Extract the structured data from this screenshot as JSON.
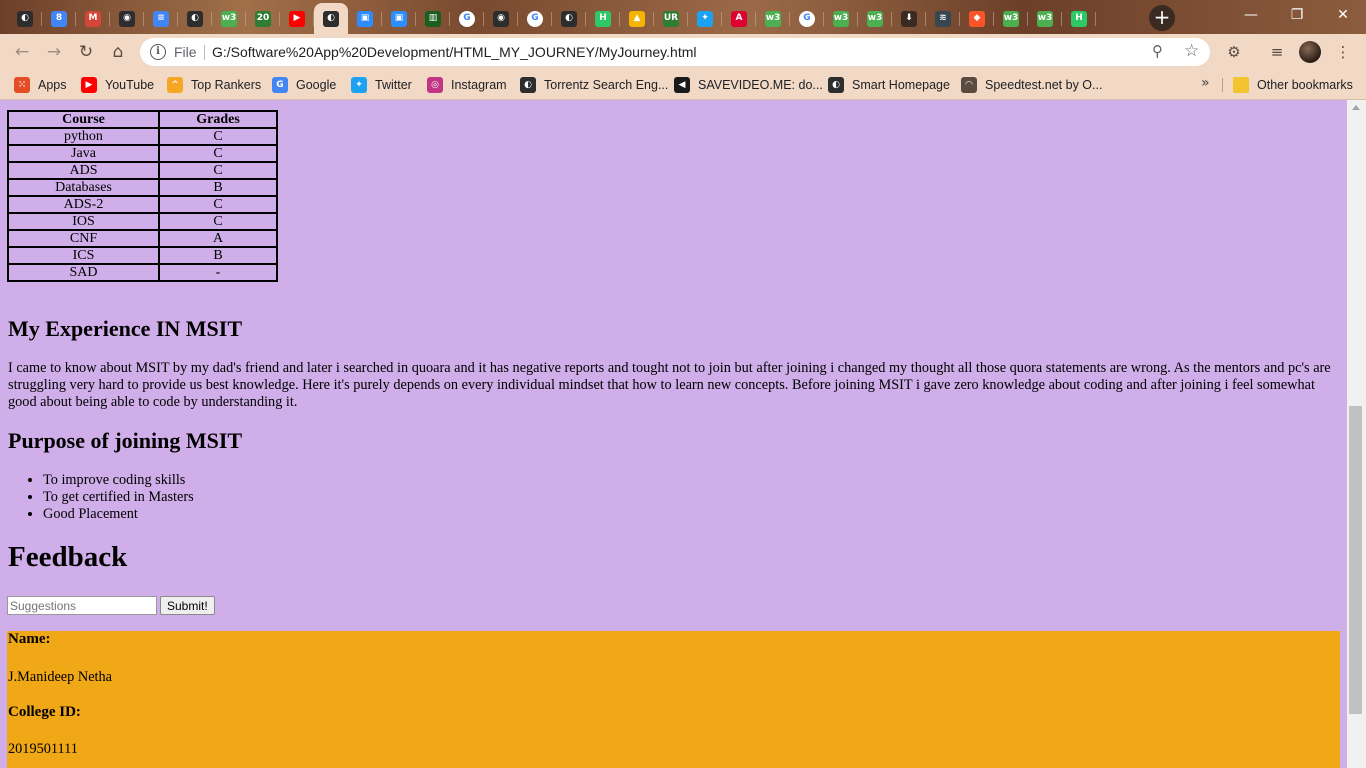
{
  "window": {
    "minimize_glyph": "—",
    "restore_glyph": "❐",
    "close_glyph": "✕",
    "new_tab_glyph": "+"
  },
  "tabs": [
    {
      "icon": "globe-icon",
      "glyph": "◐",
      "color": "#2d2d2d"
    },
    {
      "icon": "calendar-icon",
      "glyph": "8",
      "color": "#4285f4"
    },
    {
      "icon": "gmail-icon",
      "glyph": "M",
      "color": "#d44638"
    },
    {
      "icon": "github-icon",
      "glyph": "◉",
      "color": "#2d2d2d"
    },
    {
      "icon": "docs-icon",
      "glyph": "≡",
      "color": "#4285f4"
    },
    {
      "icon": "globe-icon",
      "glyph": "◐",
      "color": "#2d2d2d"
    },
    {
      "icon": "w3schools-icon",
      "glyph": "w3",
      "color": "#4caf50"
    },
    {
      "icon": "counter-icon",
      "glyph": "20",
      "color": "#2e7d32"
    },
    {
      "icon": "youtube-icon",
      "glyph": "▶",
      "color": "#ff0000"
    },
    {
      "icon": "globe-icon",
      "glyph": "◐",
      "color": "#2d2d2d",
      "active": true
    },
    {
      "icon": "zoom-icon",
      "glyph": "▣",
      "color": "#2d8cff"
    },
    {
      "icon": "zoom-icon",
      "glyph": "▣",
      "color": "#2d8cff"
    },
    {
      "icon": "chart-icon",
      "glyph": "▥",
      "color": "#1b5e20"
    },
    {
      "icon": "google-icon",
      "glyph": "G",
      "color": "#ffffff"
    },
    {
      "icon": "github-icon",
      "glyph": "◉",
      "color": "#2d2d2d"
    },
    {
      "icon": "google-icon",
      "glyph": "G",
      "color": "#ffffff"
    },
    {
      "icon": "globe-icon",
      "glyph": "◐",
      "color": "#2d2d2d"
    },
    {
      "icon": "hackerrank-icon",
      "glyph": "H",
      "color": "#2ec866"
    },
    {
      "icon": "drive-icon",
      "glyph": "▲",
      "color": "#f4b400"
    },
    {
      "icon": "unacademy-icon",
      "glyph": "UR",
      "color": "#2e7d32"
    },
    {
      "icon": "twitter-icon",
      "glyph": "✦",
      "color": "#1da1f2"
    },
    {
      "icon": "angular-icon",
      "glyph": "A",
      "color": "#dd0031"
    },
    {
      "icon": "w3schools-icon",
      "glyph": "w3",
      "color": "#4caf50"
    },
    {
      "icon": "google-icon",
      "glyph": "G",
      "color": "#ffffff"
    },
    {
      "icon": "w3schools-icon",
      "glyph": "w3",
      "color": "#4caf50"
    },
    {
      "icon": "w3schools-icon",
      "glyph": "w3",
      "color": "#4caf50"
    },
    {
      "icon": "download-icon",
      "glyph": "⬇",
      "color": "#3a2a22"
    },
    {
      "icon": "database-icon",
      "glyph": "≋",
      "color": "#37474f"
    },
    {
      "icon": "brave-icon",
      "glyph": "◆",
      "color": "#fb542b"
    },
    {
      "icon": "w3schools-icon",
      "glyph": "w3",
      "color": "#4caf50"
    },
    {
      "icon": "w3schools-icon",
      "glyph": "w3",
      "color": "#4caf50"
    },
    {
      "icon": "hackerrank-icon",
      "glyph": "H",
      "color": "#2ec866"
    }
  ],
  "toolbar": {
    "back_glyph": "←",
    "forward_glyph": "→",
    "reload_glyph": "↻",
    "home_glyph": "⌂",
    "info_glyph": "i",
    "scheme_label": "File",
    "url": "G:/Software%20App%20Development/HTML_MY_JOURNEY/MyJourney.html",
    "zoom_glyph": "⚲",
    "star_glyph": "☆",
    "extension_glyph": "⚙",
    "queue_glyph": "≡",
    "menu_glyph": "⋮"
  },
  "bookmarks": {
    "items": [
      {
        "label": "Apps",
        "icon": "apps-grid-icon",
        "glyph": "⁙",
        "color": "#e44d26"
      },
      {
        "label": "YouTube",
        "icon": "youtube-icon",
        "glyph": "▶",
        "color": "#ff0000"
      },
      {
        "label": "Top Rankers",
        "icon": "toprankers-icon",
        "glyph": "^",
        "color": "#f5a623"
      },
      {
        "label": "Google",
        "icon": "google-icon",
        "glyph": "G",
        "color": "#4285f4"
      },
      {
        "label": "Twitter",
        "icon": "twitter-icon",
        "glyph": "✦",
        "color": "#1da1f2"
      },
      {
        "label": "Instagram",
        "icon": "instagram-icon",
        "glyph": "◎",
        "color": "#c13584"
      },
      {
        "label": "Torrentz Search Eng...",
        "icon": "globe-icon",
        "glyph": "◐",
        "color": "#2d2d2d"
      },
      {
        "label": "SAVEVIDEO.ME: do...",
        "icon": "savevideo-icon",
        "glyph": "◀",
        "color": "#1a1a1a"
      },
      {
        "label": "Smart Homepage",
        "icon": "globe-icon",
        "glyph": "◐",
        "color": "#2d2d2d"
      },
      {
        "label": "Speedtest.net by O...",
        "icon": "speedtest-icon",
        "glyph": "◠",
        "color": "#5a4a40"
      }
    ],
    "more_glyph": "»",
    "other_label": "Other bookmarks"
  },
  "grades_table": {
    "headers": [
      "Course",
      "Grades"
    ],
    "rows": [
      [
        "python",
        "C"
      ],
      [
        "Java",
        "C"
      ],
      [
        "ADS",
        "C"
      ],
      [
        "Databases",
        "B"
      ],
      [
        "ADS-2",
        "C"
      ],
      [
        "IOS",
        "C"
      ],
      [
        "CNF",
        "A"
      ],
      [
        "ICS",
        "B"
      ],
      [
        "SAD",
        "-"
      ]
    ]
  },
  "experience": {
    "heading": "My Experience IN MSIT",
    "text": "I came to know about MSIT by my dad's friend and later i searched in quoara and it has negative reports and tought not to join but after joining i changed my thought all those quora statements are wrong. As the mentors and pc's are struggling very hard to provide us best knowledge. Here it's purely depends on every individual mindset that how to learn new concepts. Before joining MSIT i gave zero knowledge about coding and after joining i feel somewhat good about being able to code by understanding it."
  },
  "purpose": {
    "heading": "Purpose of joining MSIT",
    "items": [
      "To improve coding skills",
      "To get certified in Masters",
      "Good Placement"
    ]
  },
  "feedback": {
    "heading": "Feedback",
    "placeholder": "Suggestions",
    "value": "",
    "submit_label": "Submit!"
  },
  "footer": {
    "name_label": "Name:",
    "name_value": "J.Manideep Netha",
    "id_label": "College ID:",
    "id_value": "2019501111",
    "background": "#f0a816"
  },
  "colors": {
    "page_background": "#cfaee9",
    "toolbar": "#f1d9c6"
  }
}
